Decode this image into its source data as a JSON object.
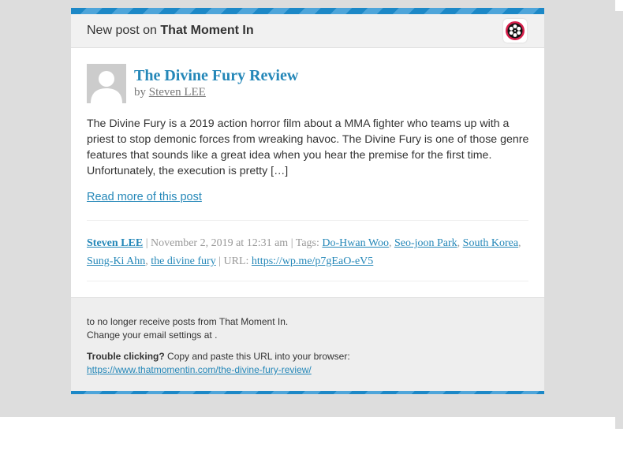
{
  "header": {
    "prefix": "New post on ",
    "site_name": "That Moment In",
    "logo_icon": "film-reel-icon"
  },
  "post": {
    "title": "The Divine Fury Review",
    "by_prefix": "by ",
    "author": "Steven LEE",
    "avatar_icon": "default-avatar-icon",
    "excerpt": "The Divine Fury is a 2019 action horror film about a MMA fighter who teams up with a priest to stop demonic forces from wreaking havoc. The Divine Fury is one of those genre features that sounds like a great idea when you hear the premise for the first time. Unfortunately, the execution is pretty […]",
    "read_more": "Read more of this post"
  },
  "meta": {
    "author": "Steven LEE",
    "sep": " | ",
    "date": "November 2, 2019 at 12:31 am",
    "tags_label": "Tags: ",
    "tags": [
      "Do-Hwan Woo",
      "Seo-joon Park",
      "South Korea",
      "Sung-Ki Ahn",
      "the divine fury"
    ],
    "tag_sep": ", ",
    "url_label": "URL: ",
    "url": "https://wp.me/p7gEaO-eV5"
  },
  "footer": {
    "unsubscribe_text": "to no longer receive posts from That Moment In.",
    "settings_text": "Change your email settings at .",
    "trouble_label": "Trouble clicking?",
    "trouble_text": " Copy and paste this URL into your browser:",
    "trouble_url": "https://www.thatmomentin.com/the-divine-fury-review/"
  },
  "colors": {
    "accent": "#2487b8",
    "stripe": "#1c88c7",
    "logo_red": "#d61f4b",
    "background": "#dddddd"
  }
}
